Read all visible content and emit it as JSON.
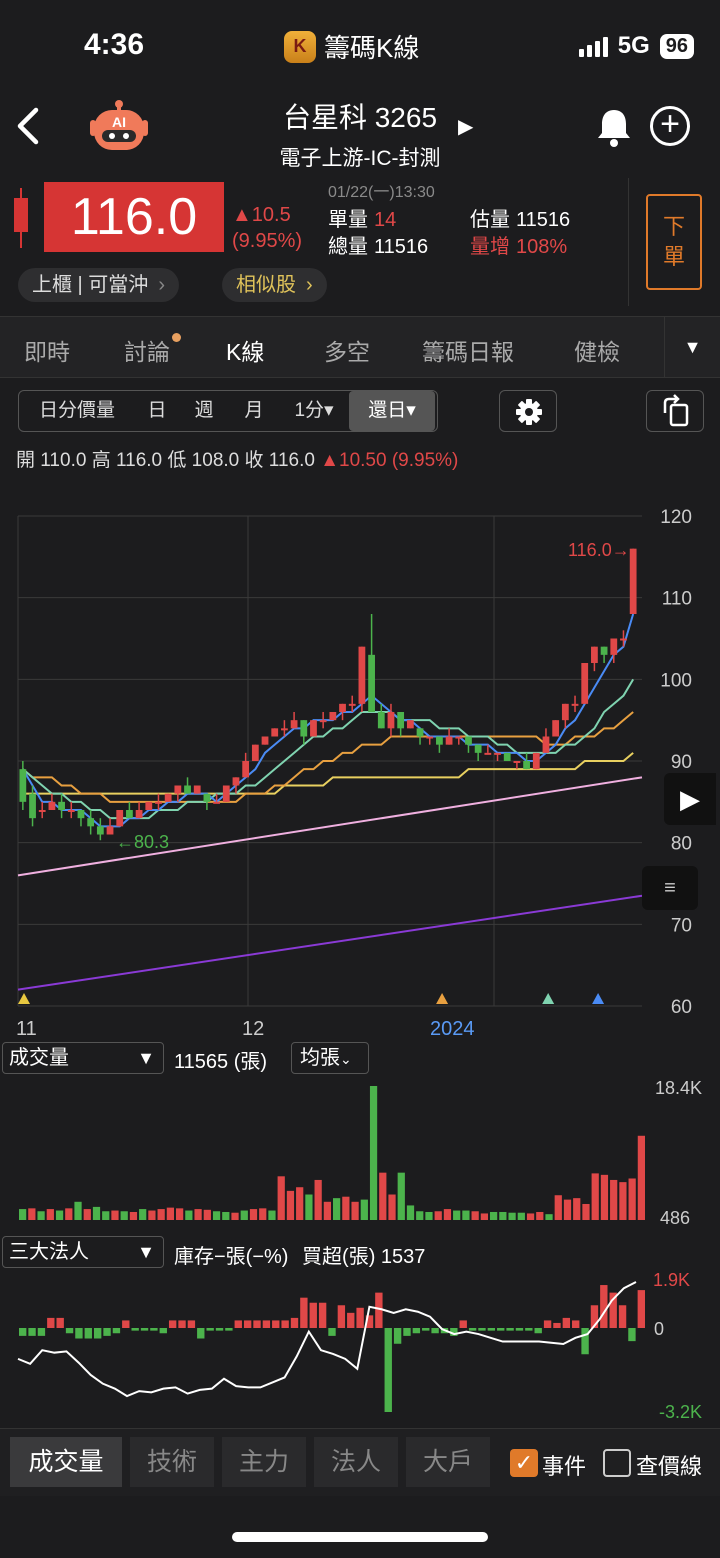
{
  "status": {
    "time": "4:36",
    "app_name": "籌碼K線",
    "network": "5G",
    "battery": "96"
  },
  "stock": {
    "title": "台星科 3265",
    "subtitle": "電子上游-IC-封測",
    "price": "116.0",
    "change": "▲10.5",
    "change_pct": "(9.95%)",
    "datetime": "01/22(一)13:30",
    "single_vol_label": "單量",
    "single_vol": "14",
    "total_vol_label": "總量",
    "total_vol": "11516",
    "est_vol_label": "估量",
    "est_vol": "11516",
    "vol_inc_label": "量增",
    "vol_inc": "108%",
    "market_tag": "上櫃 | 可當沖",
    "similar": "相似股",
    "order": "下單"
  },
  "tabs": [
    "即時",
    "討論",
    "K線",
    "多空",
    "籌碼日報",
    "健檢"
  ],
  "period_buttons": [
    "日分價量",
    "日",
    "週",
    "月",
    "1分▾",
    "還日▾"
  ],
  "ohlc": {
    "open": "開 110.0",
    "high": "高 116.0",
    "low": "低 108.0",
    "close": "收 116.0",
    "change": "▲10.50 (9.95%)"
  },
  "colors": {
    "up": "#e04848",
    "down": "#4cb34c",
    "ma5": "#4a8bf5",
    "ma10": "#7fd3b0",
    "ma20": "#e8a040",
    "ma60": "#e8d060",
    "ma120": "#f0b0e0",
    "ma240": "#8a3ad6"
  },
  "chart_data": {
    "type": "candlestick",
    "x_labels": [
      "11",
      "12",
      "2024"
    ],
    "y_ticks": [
      120,
      110,
      100,
      90,
      80,
      70,
      60
    ],
    "ylim": [
      60,
      120
    ],
    "last_price_label": "116.0→",
    "min_label": "←80.3",
    "candles": [
      [
        89,
        85,
        90,
        84
      ],
      [
        86,
        83,
        87,
        82
      ],
      [
        84,
        84,
        85,
        83
      ],
      [
        84,
        85,
        86,
        84
      ],
      [
        85,
        84,
        86,
        83
      ],
      [
        84,
        84,
        85,
        83
      ],
      [
        84,
        83,
        84,
        82
      ],
      [
        83,
        82,
        84,
        81
      ],
      [
        82,
        81,
        83,
        80.3
      ],
      [
        81,
        82,
        83,
        81
      ],
      [
        82,
        84,
        84,
        82
      ],
      [
        84,
        83,
        85,
        83
      ],
      [
        83,
        84,
        85,
        83
      ],
      [
        84,
        85,
        85,
        84
      ],
      [
        85,
        85,
        86,
        84
      ],
      [
        85,
        86,
        86,
        85
      ],
      [
        86,
        87,
        87,
        85
      ],
      [
        87,
        86,
        88,
        86
      ],
      [
        86,
        87,
        87,
        86
      ],
      [
        86,
        85,
        86,
        84
      ],
      [
        85,
        85,
        86,
        85
      ],
      [
        85,
        87,
        87,
        85
      ],
      [
        87,
        88,
        88,
        86
      ],
      [
        88,
        90,
        91,
        88
      ],
      [
        90,
        92,
        92,
        90
      ],
      [
        92,
        93,
        93,
        92
      ],
      [
        93,
        94,
        94,
        93
      ],
      [
        94,
        94,
        95,
        93
      ],
      [
        94,
        95,
        96,
        94
      ],
      [
        95,
        93,
        95,
        92
      ],
      [
        93,
        95,
        95,
        93
      ],
      [
        95,
        95,
        96,
        94
      ],
      [
        95,
        96,
        96,
        95
      ],
      [
        96,
        97,
        97,
        95
      ],
      [
        97,
        97,
        98,
        96
      ],
      [
        97,
        104,
        104,
        96
      ],
      [
        103,
        96,
        108,
        96
      ],
      [
        96,
        94,
        97,
        94
      ],
      [
        94,
        96,
        97,
        93
      ],
      [
        96,
        94,
        96,
        93
      ],
      [
        94,
        95,
        95,
        94
      ],
      [
        94,
        93,
        94,
        92
      ],
      [
        93,
        93,
        93,
        92
      ],
      [
        93,
        92,
        93,
        91
      ],
      [
        92,
        93,
        94,
        92
      ],
      [
        93,
        93,
        93,
        92
      ],
      [
        93,
        92,
        93,
        91
      ],
      [
        92,
        91,
        92,
        90
      ],
      [
        91,
        91,
        92,
        91
      ],
      [
        91,
        91,
        91,
        90
      ],
      [
        91,
        90,
        91,
        90
      ],
      [
        90,
        90,
        90,
        89
      ],
      [
        90,
        89,
        91,
        89
      ],
      [
        89,
        91,
        91,
        89
      ],
      [
        91,
        93,
        94,
        91
      ],
      [
        93,
        95,
        95,
        93
      ],
      [
        95,
        97,
        97,
        94
      ],
      [
        97,
        97,
        98,
        96
      ],
      [
        97,
        102,
        102,
        97
      ],
      [
        102,
        104,
        104,
        101
      ],
      [
        104,
        103,
        104,
        102
      ],
      [
        103,
        105,
        105,
        102
      ],
      [
        105,
        105,
        106,
        104
      ],
      [
        108,
        116,
        116,
        108
      ]
    ],
    "ma5": [
      89,
      87,
      85,
      85,
      84,
      84,
      84,
      83,
      82,
      82,
      82,
      83,
      83,
      84,
      84,
      85,
      85,
      86,
      86,
      86,
      85,
      86,
      87,
      88,
      89,
      91,
      92,
      93,
      94,
      94,
      95,
      95,
      95,
      96,
      96,
      97,
      98,
      97,
      96,
      95,
      95,
      94,
      93,
      93,
      93,
      93,
      92,
      92,
      92,
      91,
      91,
      91,
      90,
      90,
      91,
      92,
      94,
      95,
      97,
      99,
      101,
      103,
      104,
      108
    ],
    "ma10": [
      89,
      88,
      87,
      86,
      86,
      85,
      85,
      84,
      84,
      83,
      83,
      83,
      83,
      83,
      84,
      84,
      84,
      85,
      85,
      85,
      86,
      86,
      86,
      87,
      87,
      88,
      89,
      90,
      91,
      92,
      93,
      93,
      94,
      94,
      95,
      96,
      96,
      96,
      96,
      95,
      95,
      95,
      95,
      94,
      94,
      94,
      93,
      93,
      93,
      92,
      92,
      91,
      91,
      91,
      91,
      91,
      92,
      92,
      93,
      94,
      96,
      97,
      98,
      100
    ],
    "ma20": [
      89,
      88,
      88,
      88,
      87,
      87,
      86,
      86,
      86,
      85,
      85,
      85,
      85,
      85,
      85,
      85,
      85,
      85,
      85,
      85,
      85,
      85,
      85,
      86,
      86,
      86,
      87,
      87,
      88,
      89,
      89,
      90,
      90,
      91,
      91,
      92,
      92,
      92,
      93,
      93,
      93,
      93,
      93,
      93,
      93,
      93,
      93,
      93,
      93,
      93,
      93,
      93,
      93,
      93,
      92,
      92,
      92,
      93,
      93,
      93,
      94,
      94,
      95,
      96
    ],
    "ma60": [
      86,
      86,
      86,
      86,
      86,
      86,
      86,
      86,
      86,
      86,
      86,
      86,
      86,
      86,
      86,
      86,
      86,
      86,
      86,
      86,
      86,
      86,
      86,
      86,
      86,
      86,
      86,
      87,
      87,
      87,
      87,
      87,
      88,
      88,
      88,
      88,
      88,
      88,
      88,
      88,
      88,
      88,
      88,
      88,
      88,
      88,
      89,
      89,
      89,
      89,
      89,
      89,
      89,
      89,
      89,
      89,
      89,
      89,
      90,
      90,
      90,
      90,
      90,
      91
    ],
    "ma120_range": [
      76,
      88
    ],
    "ma240_range": [
      62,
      73.5
    ],
    "event_markers": [
      {
        "pos": 0,
        "color": "#e8c840"
      },
      {
        "pos": 0.67,
        "color": "#e8a040"
      },
      {
        "pos": 0.84,
        "color": "#7fd3b0"
      },
      {
        "pos": 0.92,
        "color": "#4a8bf5"
      }
    ]
  },
  "volume": {
    "selector": "成交量",
    "value": "11565 (張)",
    "avg": "均張",
    "max_label": "18.4K",
    "min_label": "486",
    "bars": [
      1500,
      1600,
      1200,
      1500,
      1300,
      1600,
      2500,
      1500,
      1800,
      1200,
      1300,
      1200,
      1100,
      1500,
      1300,
      1500,
      1700,
      1600,
      1300,
      1500,
      1400,
      1200,
      1100,
      1000,
      1300,
      1500,
      1600,
      1300,
      6000,
      4000,
      4500,
      3500,
      5500,
      2500,
      3000,
      3200,
      2500,
      2800,
      18400,
      6500,
      3500,
      6500,
      2000,
      1200,
      1100,
      1200,
      1500,
      1300,
      1300,
      1200,
      900,
      1100,
      1100,
      1000,
      1000,
      900,
      1100,
      800,
      3400,
      2800,
      3000,
      2200,
      6400,
      6200,
      5500,
      5200,
      5700,
      11565
    ],
    "bar_up": [
      0,
      1,
      0,
      1,
      0,
      1,
      0,
      1,
      0,
      0,
      1,
      0,
      1,
      0,
      1,
      1,
      1,
      1,
      0,
      1,
      1,
      0,
      0,
      1,
      0,
      1,
      1,
      0,
      1,
      1,
      1,
      0,
      1,
      1,
      0,
      1,
      1,
      0,
      0,
      1,
      1,
      0,
      0,
      0,
      0,
      1,
      1,
      0,
      0,
      1,
      1,
      0,
      0,
      0,
      0,
      1,
      1,
      0,
      1,
      1,
      1,
      1,
      1,
      1,
      1,
      1,
      1,
      1
    ]
  },
  "institutional": {
    "selector": "三大法人",
    "label": "庫存−張(−%)",
    "net_buy": "買超(張) 1537",
    "max_label": "1.9K",
    "zero_label": "0",
    "min_label": "-3.2K",
    "bars": [
      -300,
      -300,
      -300,
      400,
      400,
      -200,
      -400,
      -400,
      -400,
      -300,
      -200,
      300,
      -100,
      -100,
      -100,
      -200,
      300,
      300,
      300,
      -400,
      -100,
      -100,
      -100,
      300,
      300,
      300,
      300,
      300,
      300,
      400,
      1200,
      1000,
      1000,
      -300,
      900,
      600,
      800,
      500,
      1400,
      -3200,
      -600,
      -300,
      -200,
      -100,
      -200,
      -200,
      -300,
      300,
      -100,
      -100,
      -100,
      -100,
      -100,
      -100,
      -100,
      -200,
      300,
      200,
      400,
      300,
      -1000,
      900,
      1700,
      1400,
      900,
      -500,
      1500
    ],
    "line": [
      0.62,
      0.66,
      0.55,
      0.57,
      0.56,
      0.65,
      0.75,
      0.82,
      0.86,
      0.92,
      0.88,
      0.89,
      0.86,
      0.85,
      0.9,
      0.87,
      0.86,
      0.78,
      0.84,
      0.85,
      0.85,
      0.81,
      0.77,
      0.6,
      0.4,
      0.55,
      0.58,
      0.62,
      0.7,
      0.2,
      0.22,
      0.25,
      0.22,
      0.24,
      0.28,
      0.38,
      0.42,
      0.4,
      0.42,
      0.45,
      0.48,
      0.48,
      0.48,
      0.48,
      0.49,
      0.5,
      0.45,
      0.42,
      0.3,
      0.15,
      0.05,
      0.0
    ]
  },
  "bottom_tabs": [
    "成交量",
    "技術",
    "主力",
    "法人",
    "大戶"
  ],
  "bottom_checks": {
    "event": "事件",
    "price_line": "查價線"
  }
}
